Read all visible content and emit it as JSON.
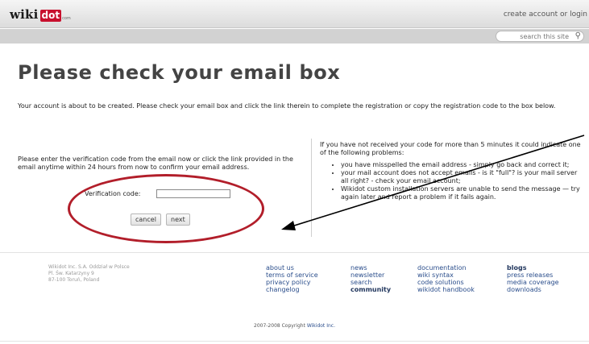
{
  "header": {
    "logo": {
      "wiki": "wiki",
      "dot": "dot",
      "com": "com"
    },
    "account_link": "create account or login"
  },
  "search": {
    "placeholder": "search this site",
    "icon": "search-icon"
  },
  "main": {
    "title": "Please check your email box",
    "intro": "Your account is about to be created. Please check your email box and click the link therein to complete the registration or copy the registration code to the box below.",
    "instructions": "Please enter the verification code from the email now or click the link provided in the email anytime within 24 hours from now to confirm your email address.",
    "code_label": "Verification code:",
    "code_value": "",
    "cancel_label": "cancel",
    "next_label": "next"
  },
  "problems": {
    "intro": "If you have not received your code for more than 5 minutes it could indicate one of the following problems:",
    "items": [
      "you have misspelled the email address - simply go back and correct it;",
      "your mail account does not accept emails - is it \"full\"? is your mail server all right? - check your email account;",
      "Wikidot custom installation servers are unable to send the message — try again later and report a problem if it fails again."
    ]
  },
  "annotation": {
    "color": "#b21e2a"
  },
  "footer": {
    "address": [
      "Wikidot Inc. S.A. Oddział w Polsce",
      "Pl. Św. Katarzyny 9",
      "87-100 Toruń, Poland"
    ],
    "columns": [
      [
        {
          "label": "about us"
        },
        {
          "label": "terms of service"
        },
        {
          "label": "privacy policy"
        },
        {
          "label": "changelog"
        }
      ],
      [
        {
          "label": "news"
        },
        {
          "label": "newsletter"
        },
        {
          "label": "search"
        },
        {
          "label": "community",
          "bold": true
        }
      ],
      [
        {
          "label": "documentation"
        },
        {
          "label": "wiki syntax"
        },
        {
          "label": "code solutions"
        },
        {
          "label": "wikidot handbook"
        }
      ],
      [
        {
          "label": "blogs",
          "bold": true
        },
        {
          "label": "press releases"
        },
        {
          "label": "media coverage"
        },
        {
          "label": "downloads"
        }
      ]
    ],
    "copyright_prefix": "2007-2008 Copyright ",
    "copyright_link": "Wikidot Inc."
  }
}
